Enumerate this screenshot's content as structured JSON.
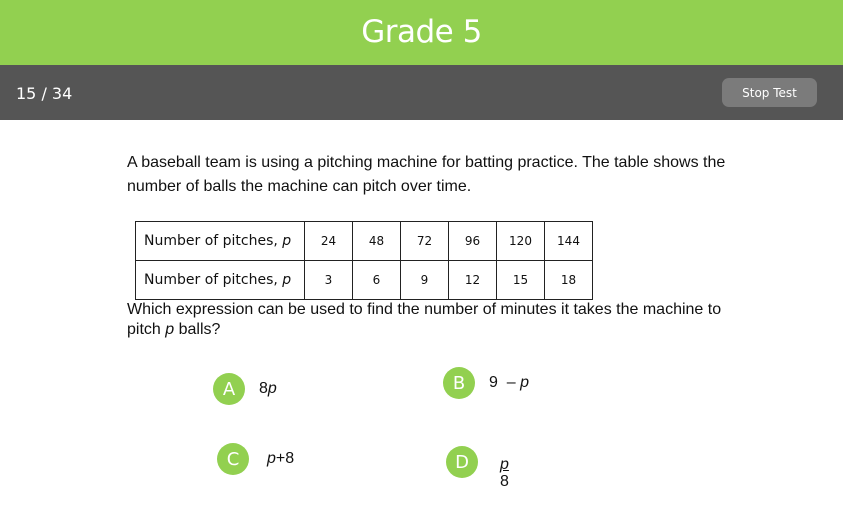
{
  "header": {
    "title": "Grade 5"
  },
  "navbar": {
    "progress": "15 / 34",
    "stop_label": "Stop Test"
  },
  "question": {
    "stem": "A baseball team is using a pitching machine for batting practice.  The table shows the number of balls the machine can pitch over time.",
    "prompt_pre": "Which expression can be used to find the number of minutes it takes the machine to pitch ",
    "prompt_var": "p",
    "prompt_post": " balls?"
  },
  "table": {
    "rows": [
      {
        "label": "Number of pitches, ",
        "var": "p",
        "values": [
          "24",
          "48",
          "72",
          "96",
          "120",
          "144"
        ]
      },
      {
        "label": "Number of pitches, ",
        "var": "p",
        "values": [
          "3",
          "6",
          "9",
          "12",
          "15",
          "18"
        ]
      }
    ]
  },
  "options": [
    {
      "letter": "A",
      "expr_num": "8",
      "expr_var": "p"
    },
    {
      "letter": "B",
      "expr_num": "9",
      "expr_op": " –",
      "expr_var": "p"
    },
    {
      "letter": "C",
      "expr_var": "p",
      "expr_rest": "+8"
    },
    {
      "letter": "D",
      "frac_num": "p",
      "frac_den": "8"
    }
  ],
  "colors": {
    "accent": "#92d050",
    "navbar": "#555555",
    "button": "#7b7b7b"
  }
}
